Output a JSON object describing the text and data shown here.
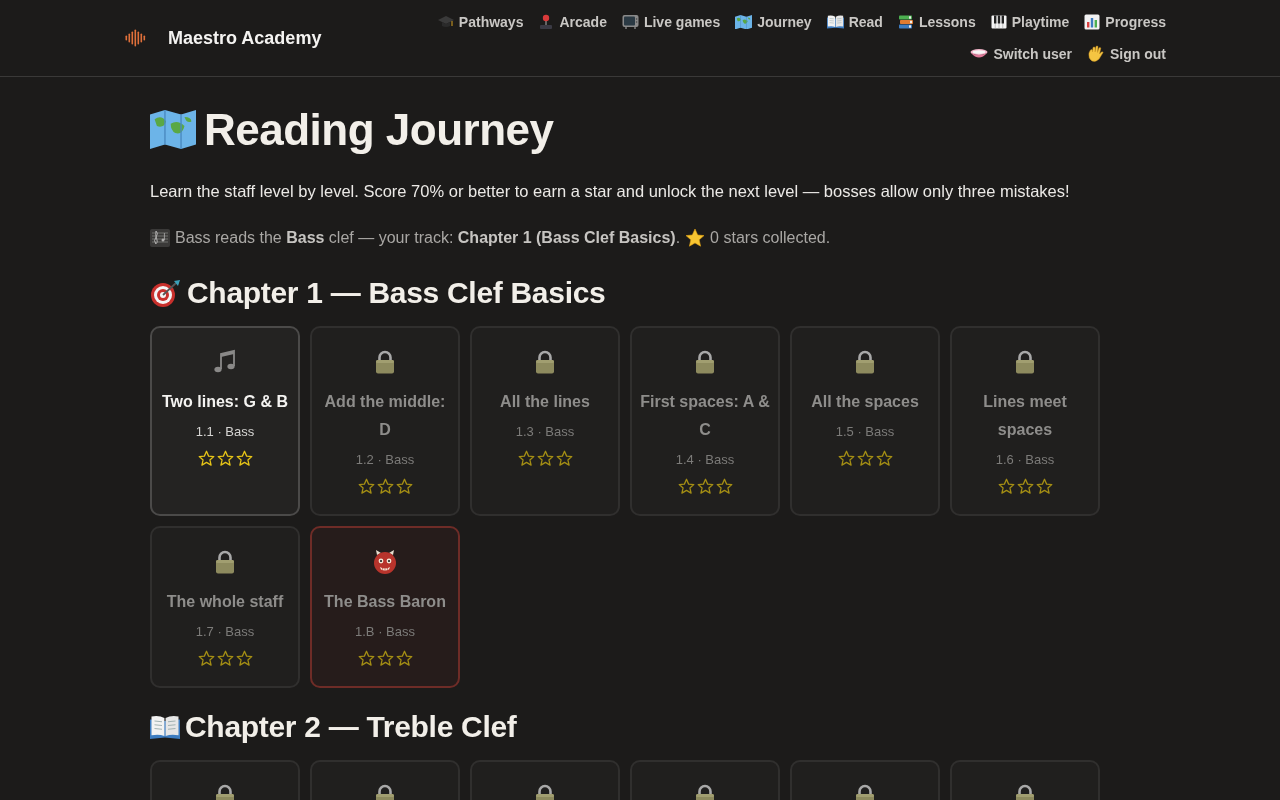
{
  "header": {
    "brand": "Maestro Academy",
    "nav": [
      "Pathways",
      "Arcade",
      "Live games",
      "Journey",
      "Read",
      "Lessons",
      "Playtime",
      "Progress"
    ],
    "account_nav": [
      "Switch user",
      "Sign out"
    ]
  },
  "page": {
    "title": "Reading Journey",
    "intro": "Learn the staff level by level. Score 70% or better to earn a star and unlock the next level — bosses allow only three mistakes!",
    "track_note": "Bass reads the **Bass** clef — your track: **Chapter 1 (Bass Clef Basics)**.",
    "stars_note": "0 stars collected."
  },
  "chapters": [
    {
      "title": "Chapter 1 — Bass Clef Basics",
      "levels": [
        {
          "kind": "level",
          "locked": false,
          "title": "Two lines: G & B",
          "subtitle": "1.1 · Bass",
          "stars": 0
        },
        {
          "kind": "level",
          "locked": true,
          "title": "Add the middle: D",
          "subtitle": "1.2 · Bass",
          "stars": 0
        },
        {
          "kind": "level",
          "locked": true,
          "title": "All the lines",
          "subtitle": "1.3 · Bass",
          "stars": 0
        },
        {
          "kind": "level",
          "locked": true,
          "title": "First spaces: A & C",
          "subtitle": "1.4 · Bass",
          "stars": 0
        },
        {
          "kind": "level",
          "locked": true,
          "title": "All the spaces",
          "subtitle": "1.5 · Bass",
          "stars": 0
        },
        {
          "kind": "level",
          "locked": true,
          "title": "Lines meet spaces",
          "subtitle": "1.6 · Bass",
          "stars": 0
        },
        {
          "kind": "level",
          "locked": true,
          "title": "The whole staff",
          "subtitle": "1.7 · Bass",
          "stars": 0
        },
        {
          "kind": "boss",
          "locked": true,
          "title": "The Bass Baron",
          "subtitle": "1.B · Bass",
          "stars": 0
        }
      ]
    },
    {
      "title": "Chapter 2 — Treble Clef",
      "levels": [
        {
          "kind": "level",
          "locked": true
        },
        {
          "kind": "level",
          "locked": true
        },
        {
          "kind": "level",
          "locked": true
        },
        {
          "kind": "level",
          "locked": true
        },
        {
          "kind": "level",
          "locked": true
        },
        {
          "kind": "level",
          "locked": true
        }
      ]
    }
  ]
}
